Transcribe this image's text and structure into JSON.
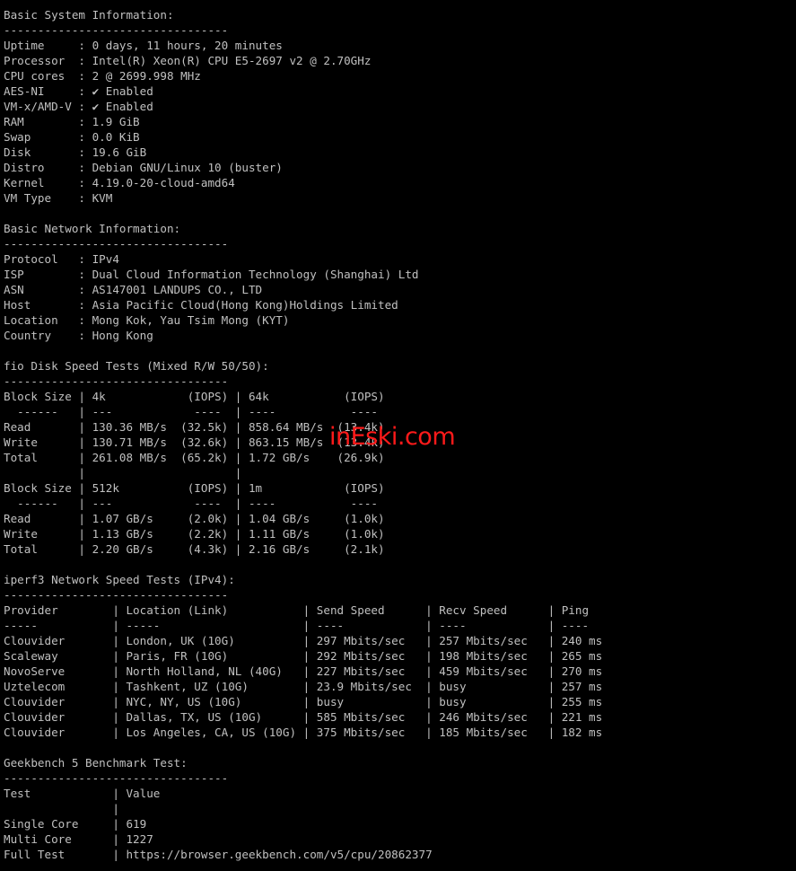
{
  "terminal": {
    "lines": [
      "Basic System Information:",
      "---------------------------------",
      "Uptime     : 0 days, 11 hours, 20 minutes",
      "Processor  : Intel(R) Xeon(R) CPU E5-2697 v2 @ 2.70GHz",
      "CPU cores  : 2 @ 2699.998 MHz",
      "AES-NI     : ✔ Enabled",
      "VM-x/AMD-V : ✔ Enabled",
      "RAM        : 1.9 GiB",
      "Swap       : 0.0 KiB",
      "Disk       : 19.6 GiB",
      "Distro     : Debian GNU/Linux 10 (buster)",
      "Kernel     : 4.19.0-20-cloud-amd64",
      "VM Type    : KVM",
      "",
      "Basic Network Information:",
      "---------------------------------",
      "Protocol   : IPv4",
      "ISP        : Dual Cloud Information Technology (Shanghai) Ltd",
      "ASN        : AS147001 LANDUPS CO., LTD",
      "Host       : Asia Pacific Cloud(Hong Kong)Holdings Limited",
      "Location   : Mong Kok, Yau Tsim Mong (KYT)",
      "Country    : Hong Kong",
      "",
      "fio Disk Speed Tests (Mixed R/W 50/50):",
      "---------------------------------",
      "Block Size | 4k            (IOPS) | 64k           (IOPS)",
      "  ------   | ---            ----  | ----           ----",
      "Read       | 130.36 MB/s  (32.5k) | 858.64 MB/s  (13.4k)",
      "Write      | 130.71 MB/s  (32.6k) | 863.15 MB/s  (13.4k)",
      "Total      | 261.08 MB/s  (65.2k) | 1.72 GB/s    (26.9k)",
      "           |                      |",
      "Block Size | 512k          (IOPS) | 1m            (IOPS)",
      "  ------   | ---            ----  | ----           ----",
      "Read       | 1.07 GB/s     (2.0k) | 1.04 GB/s     (1.0k)",
      "Write      | 1.13 GB/s     (2.2k) | 1.11 GB/s     (1.0k)",
      "Total      | 2.20 GB/s     (4.3k) | 2.16 GB/s     (2.1k)",
      "",
      "iperf3 Network Speed Tests (IPv4):",
      "---------------------------------",
      "Provider        | Location (Link)           | Send Speed      | Recv Speed      | Ping",
      "-----           | -----                     | ----            | ----            | ----",
      "Clouvider       | London, UK (10G)          | 297 Mbits/sec   | 257 Mbits/sec   | 240 ms",
      "Scaleway        | Paris, FR (10G)           | 292 Mbits/sec   | 198 Mbits/sec   | 265 ms",
      "NovoServe       | North Holland, NL (40G)   | 227 Mbits/sec   | 459 Mbits/sec   | 270 ms",
      "Uztelecom       | Tashkent, UZ (10G)        | 23.9 Mbits/sec  | busy            | 257 ms",
      "Clouvider       | NYC, NY, US (10G)         | busy            | busy            | 255 ms",
      "Clouvider       | Dallas, TX, US (10G)      | 585 Mbits/sec   | 246 Mbits/sec   | 221 ms",
      "Clouvider       | Los Angeles, CA, US (10G) | 375 Mbits/sec   | 185 Mbits/sec   | 182 ms",
      "",
      "Geekbench 5 Benchmark Test:",
      "---------------------------------",
      "Test            | Value",
      "                |",
      "Single Core     | 619",
      "Multi Core      | 1227",
      "Full Test       | https://browser.geekbench.com/v5/cpu/20862377"
    ]
  },
  "watermark": {
    "text": "inEski.com",
    "color": "#ff1a1a"
  },
  "colors": {
    "background": "#000000",
    "foreground": "#c0c0c0"
  }
}
